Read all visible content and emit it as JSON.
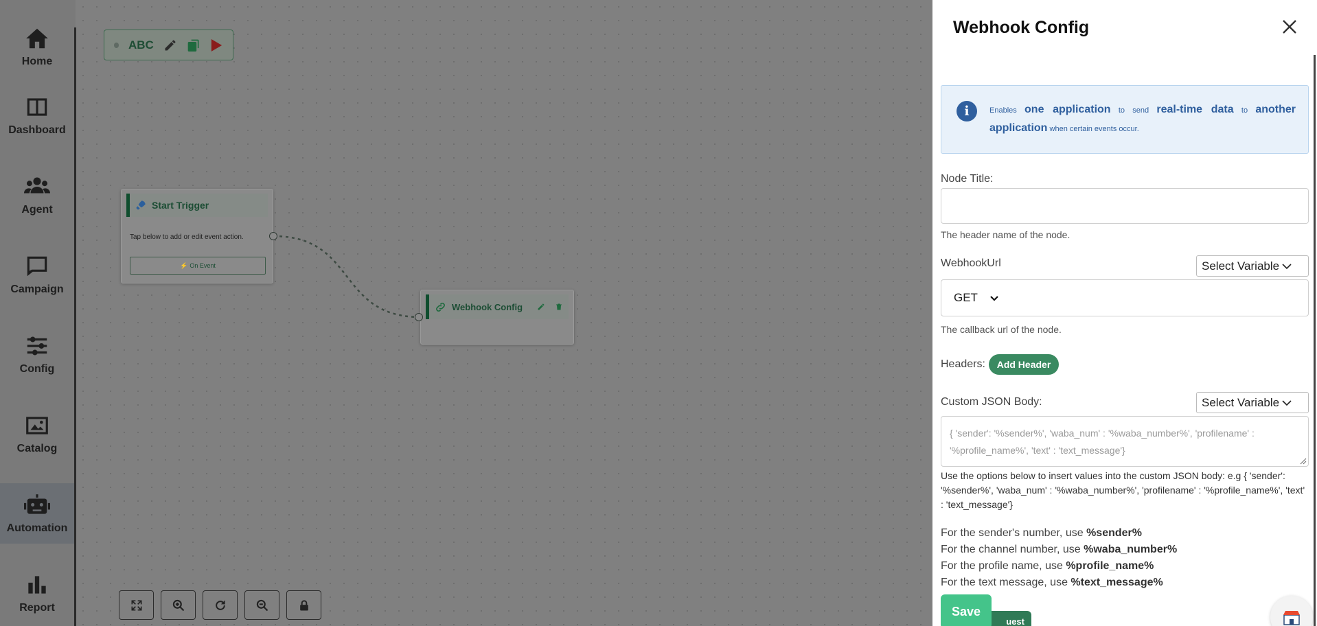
{
  "sidebar": {
    "items": [
      {
        "label": "Home",
        "icon": "home-icon"
      },
      {
        "label": "Dashboard",
        "icon": "dashboard-icon"
      },
      {
        "label": "Agent",
        "icon": "agent-icon"
      },
      {
        "label": "Campaign",
        "icon": "campaign-icon"
      },
      {
        "label": "Config",
        "icon": "sliders-icon"
      },
      {
        "label": "Catalog",
        "icon": "image-icon"
      },
      {
        "label": "Automation",
        "icon": "robot-icon",
        "active": true
      },
      {
        "label": "Report",
        "icon": "bar-chart-icon"
      }
    ]
  },
  "canvas": {
    "flow_name": "ABC",
    "start_node": {
      "title": "Start Trigger",
      "description": "Tap below to add or edit event action.",
      "event_button": "On Event"
    },
    "webhook_node": {
      "title": "Webhook Config"
    }
  },
  "panel": {
    "title": "Webhook Config",
    "info": {
      "p1": "Enables ",
      "b1": "one application",
      "p2": " to send ",
      "b2": "real-time data",
      "p3": " to ",
      "b3": "another application",
      "p4": " when certain events occur."
    },
    "node_title": {
      "label": "Node Title:",
      "value": "",
      "hint": "The header name of the node."
    },
    "webhook_url": {
      "label": "WebhookUrl",
      "select_variable": "Select Variable",
      "method": "GET",
      "hint": "The callback url of the node."
    },
    "headers": {
      "label": "Headers:",
      "add_button": "Add Header"
    },
    "custom_json": {
      "label": "Custom JSON Body:",
      "select_variable": "Select Variable",
      "placeholder": "{ 'sender': '%sender%', 'waba_num' : '%waba_number%', 'profilename' : '%profile_name%', 'text' : 'text_message'}",
      "help": "Use the options below to insert values into the custom JSON body: e.g { 'sender': '%sender%', 'waba_num' : '%waba_number%', 'profilename' : '%profile_name%', 'text' : 'text_message'}"
    },
    "variables": [
      {
        "text": "For the sender's number, use ",
        "var": "%sender%"
      },
      {
        "text": "For the channel number, use ",
        "var": "%waba_number%"
      },
      {
        "text": "For the profile name, use ",
        "var": "%profile_name%"
      },
      {
        "text": "For the text message, use ",
        "var": "%text_message%"
      }
    ],
    "save_button": "Save",
    "test_button": "uest"
  },
  "colors": {
    "accent_green": "#3a8a61",
    "save_green": "#44c48a",
    "info_blue": "#2f5f9e",
    "info_bg": "#e8f1fa"
  }
}
